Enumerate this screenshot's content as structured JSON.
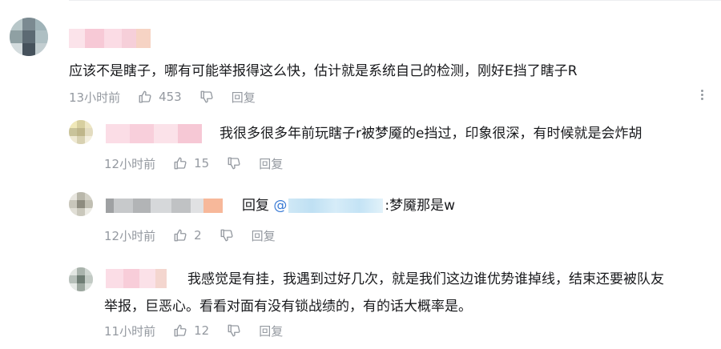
{
  "comments": [
    {
      "text": "应该不是瞎子，哪有可能举报得这么快，估计就是系统自己的检测，刚好E挡了瞎子R",
      "time": "13小时前",
      "likes": "453",
      "reply_label": "回复"
    },
    {
      "text": "我很多很多年前玩瞎子r被梦魇的e挡过，印象很深，有时候就是会炸胡",
      "time": "12小时前",
      "likes": "15",
      "reply_label": "回复"
    },
    {
      "reply_prefix": "回复",
      "mention_open": "@",
      "text": ":梦魇那是w",
      "time": "12小时前",
      "likes": "2",
      "reply_label": "回复"
    },
    {
      "text_line1": "我感觉是有挂，我遇到过好几次，就是我们这边谁优势谁掉线，结束还要被队友",
      "text_line2": "举报，巨恶心。看看对面有没有锁战绩的，有的话大概率是。",
      "time": "11小时前",
      "likes": "12",
      "reply_label": "回复"
    }
  ],
  "icons": {
    "like": "thumb-up-icon",
    "dislike": "thumb-down-icon",
    "more": "more-vertical-icon"
  },
  "colors": {
    "text": "#18191c",
    "meta": "#9499a0",
    "mention": "#3a7bd5"
  }
}
